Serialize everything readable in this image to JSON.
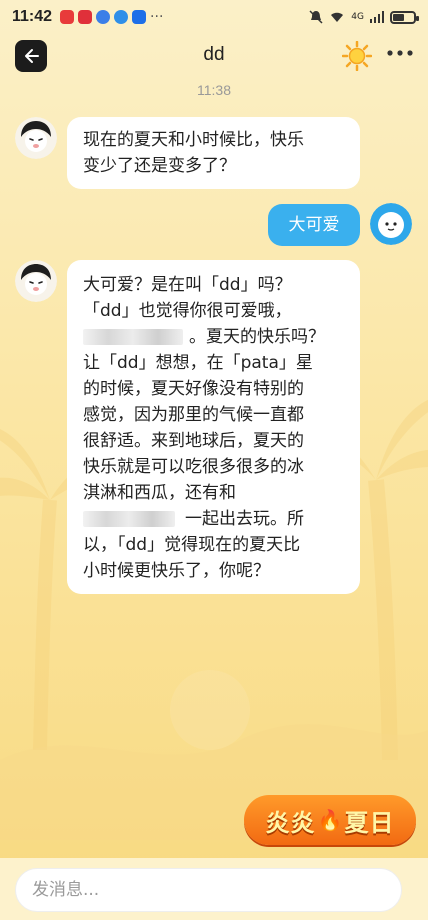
{
  "status_bar": {
    "time": "11:42",
    "app_icon_colors": [
      "#e83b3b",
      "#e0303a",
      "#3b7fe8",
      "#2f8fe8",
      "#1d6fe8"
    ],
    "overflow_dots": "···",
    "network": "4G",
    "battery_level": 0.55
  },
  "header": {
    "back_icon": "arrow-left-icon",
    "title": "dd",
    "theme_icon": "sun-icon",
    "more_icon": "more-horizontal-icon"
  },
  "chat": {
    "timestamp": "11:38",
    "messages": [
      {
        "sender": "bot",
        "lines": [
          "现在的夏天和小时候比，快乐",
          "变少了还是变多了？"
        ]
      },
      {
        "sender": "user",
        "text": "大可爱"
      },
      {
        "sender": "bot",
        "line1": "大可爱？是在叫「dd」吗？",
        "line2": "「dd」也觉得你很可爱哦，",
        "line3_after_redaction": "。夏天的快乐吗？",
        "line4": "让「dd」想想，在「pata」星",
        "line5": "的时候，夏天好像没有特别的",
        "line6": "感觉，因为那里的气候一直都",
        "line7": "很舒适。来到地球后，夏天的",
        "line8": "快乐就是可以吃很多很多的冰",
        "line9": "淇淋和西瓜，还有和",
        "line10_after_redaction": "一起出去玩。所",
        "line11": "以，「dd」觉得现在的夏天比",
        "line12": "小时候更快乐了，你呢？"
      }
    ]
  },
  "badge": {
    "part1": "炎炎",
    "flame": "🔥",
    "part2": "夏日"
  },
  "composer": {
    "placeholder": "发消息..."
  },
  "colors": {
    "background": "#fbe6a4",
    "user_bubble": "#3ab0ee",
    "bot_bubble": "#ffffff",
    "badge_orange": "#f26a12"
  }
}
